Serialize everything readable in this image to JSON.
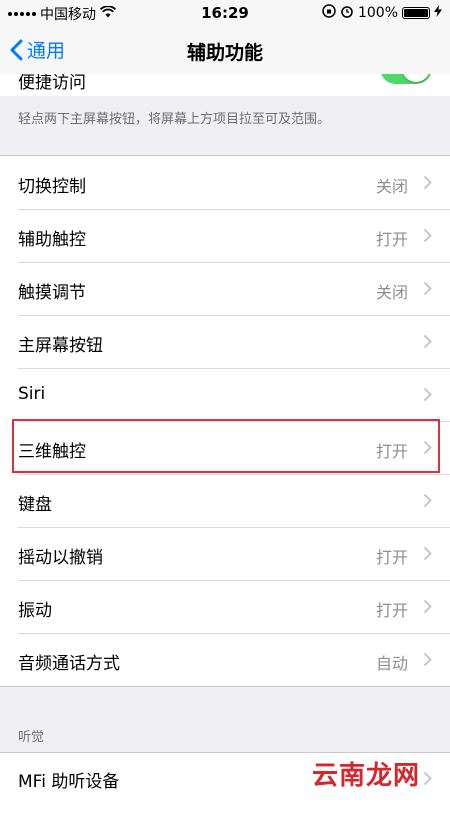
{
  "status_bar": {
    "carrier": "中国移动",
    "time": "16:29",
    "battery": "100%"
  },
  "nav": {
    "back_label": "通用",
    "title": "辅助功能"
  },
  "partial_row": {
    "label": "便捷访问",
    "toggle_on": true
  },
  "description": "轻点两下主屏幕按钮，将屏幕上方项目拉至可及范围。",
  "rows": [
    {
      "label": "切换控制",
      "value": "关闭"
    },
    {
      "label": "辅助触控",
      "value": "打开"
    },
    {
      "label": "触摸调节",
      "value": "关闭"
    },
    {
      "label": "主屏幕按钮",
      "value": ""
    },
    {
      "label": "Siri",
      "value": ""
    },
    {
      "label": "三维触控",
      "value": "打开"
    },
    {
      "label": "键盘",
      "value": ""
    },
    {
      "label": "摇动以撤销",
      "value": "打开"
    },
    {
      "label": "振动",
      "value": "打开"
    },
    {
      "label": "音频通话方式",
      "value": "自动"
    }
  ],
  "hearing_section": {
    "header": "听觉",
    "rows": [
      {
        "label": "MFi 助听设备"
      }
    ]
  },
  "watermark": "云南龙网",
  "colors": {
    "accent": "#007aff",
    "toggle_on": "#4cd964",
    "highlight": "#d8343a"
  }
}
